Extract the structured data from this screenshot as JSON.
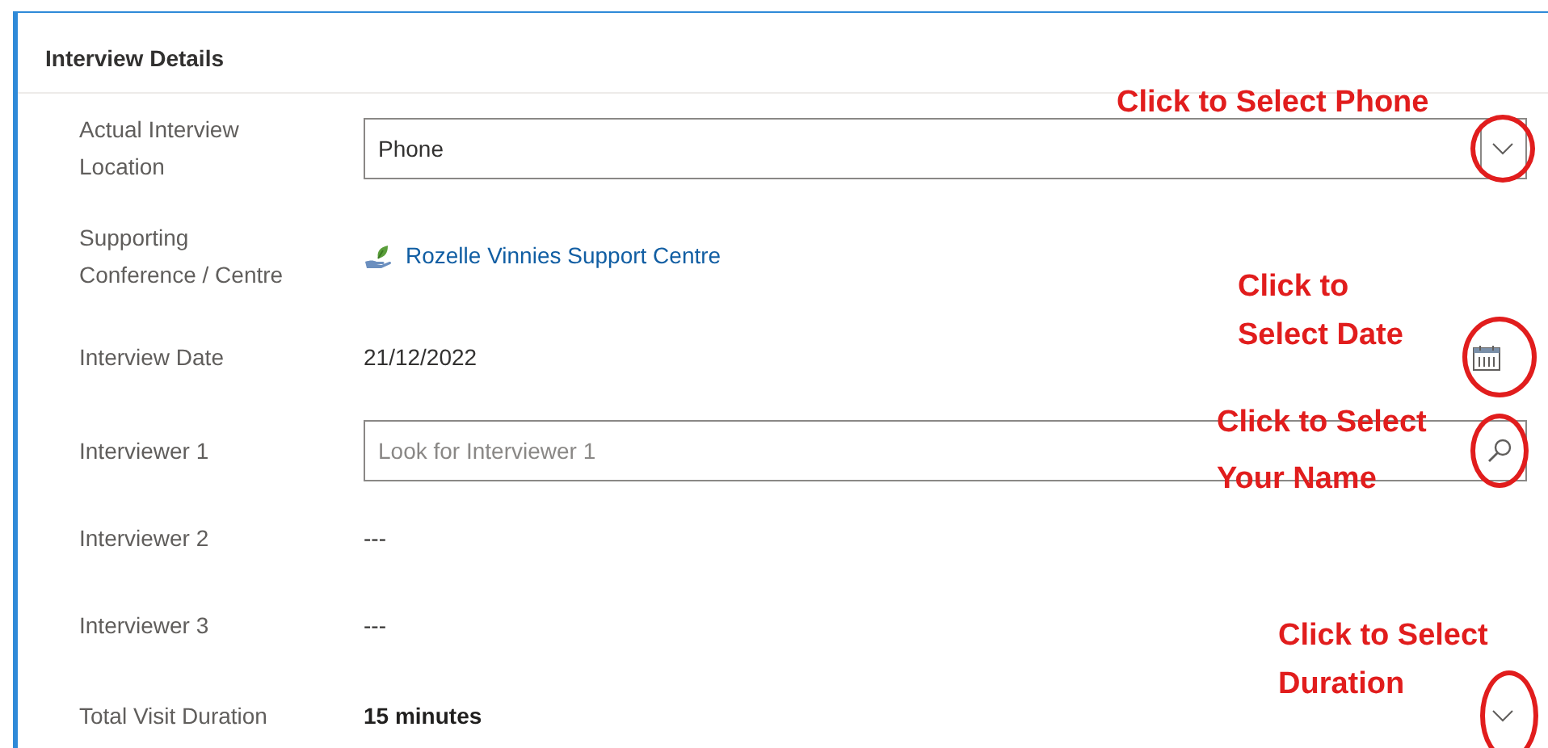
{
  "section": {
    "title": "Interview Details"
  },
  "fields": [
    {
      "label": "Actual Interview Location",
      "kind": "select",
      "value": "Phone",
      "note": "Click to Select Phone"
    },
    {
      "label": "Supporting Conference / Centre",
      "kind": "link",
      "value": "Rozelle Vinnies Support Centre"
    },
    {
      "label": "Interview Date",
      "kind": "date",
      "value": "21/12/2022",
      "note": "Click to Select Date"
    },
    {
      "label": "Interviewer 1",
      "kind": "lookup",
      "placeholder": "Look for Interviewer 1",
      "note": "Click to Select Your Name"
    },
    {
      "label": "Interviewer 2",
      "kind": "text",
      "value": "---"
    },
    {
      "label": "Interviewer 3",
      "kind": "text",
      "value": "---"
    },
    {
      "label": "Total Visit Duration",
      "kind": "option",
      "value": "15 minutes",
      "note": "Click to Select Duration"
    }
  ]
}
